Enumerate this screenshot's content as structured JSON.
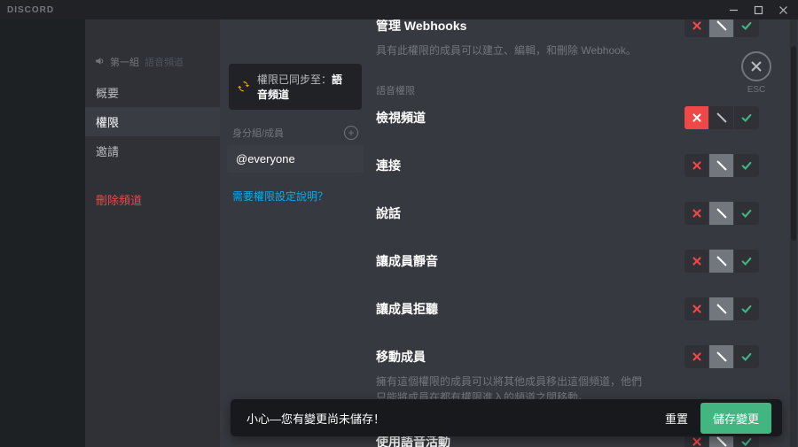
{
  "titlebar": {
    "logo": "DISCORD"
  },
  "esc_label": "ESC",
  "sidebar": {
    "header_prefix": "第一組",
    "header_suffix": "語音頻道",
    "items": [
      "概要",
      "權限",
      "邀請"
    ],
    "active_index": 1,
    "delete_label": "刪除頻道"
  },
  "midcol": {
    "sync_prefix": "權限已同步至：",
    "sync_category": "語音頻道",
    "roles_header": "身分組/成員",
    "role": "@everyone",
    "help_link": "需要權限設定說明？"
  },
  "section_label_voice": "語音權限",
  "permissions": [
    {
      "title": "管理 Webhooks",
      "desc": "具有此權限的成員可以建立、編輯，和刪除 Webhook。",
      "state": "neut",
      "show_section_after": false
    },
    {
      "title": "檢視頻道",
      "desc": "",
      "state": "deny",
      "show_section_before": true
    },
    {
      "title": "連接",
      "desc": "",
      "state": "neut"
    },
    {
      "title": "說話",
      "desc": "",
      "state": "neut"
    },
    {
      "title": "讓成員靜音",
      "desc": "",
      "state": "neut"
    },
    {
      "title": "讓成員拒聽",
      "desc": "",
      "state": "neut"
    },
    {
      "title": "移動成員",
      "desc": "擁有這個權限的成員可以將其他成員移出這個頻道，他們只能將成員在都有權限進入的頻道之間移動。",
      "state": "neut"
    },
    {
      "title": "使用語音活動",
      "desc": "",
      "state": "neut"
    }
  ],
  "saveprompt": {
    "message": "小心—您有變更尚未儲存！",
    "reset": "重置",
    "save": "儲存變更"
  }
}
